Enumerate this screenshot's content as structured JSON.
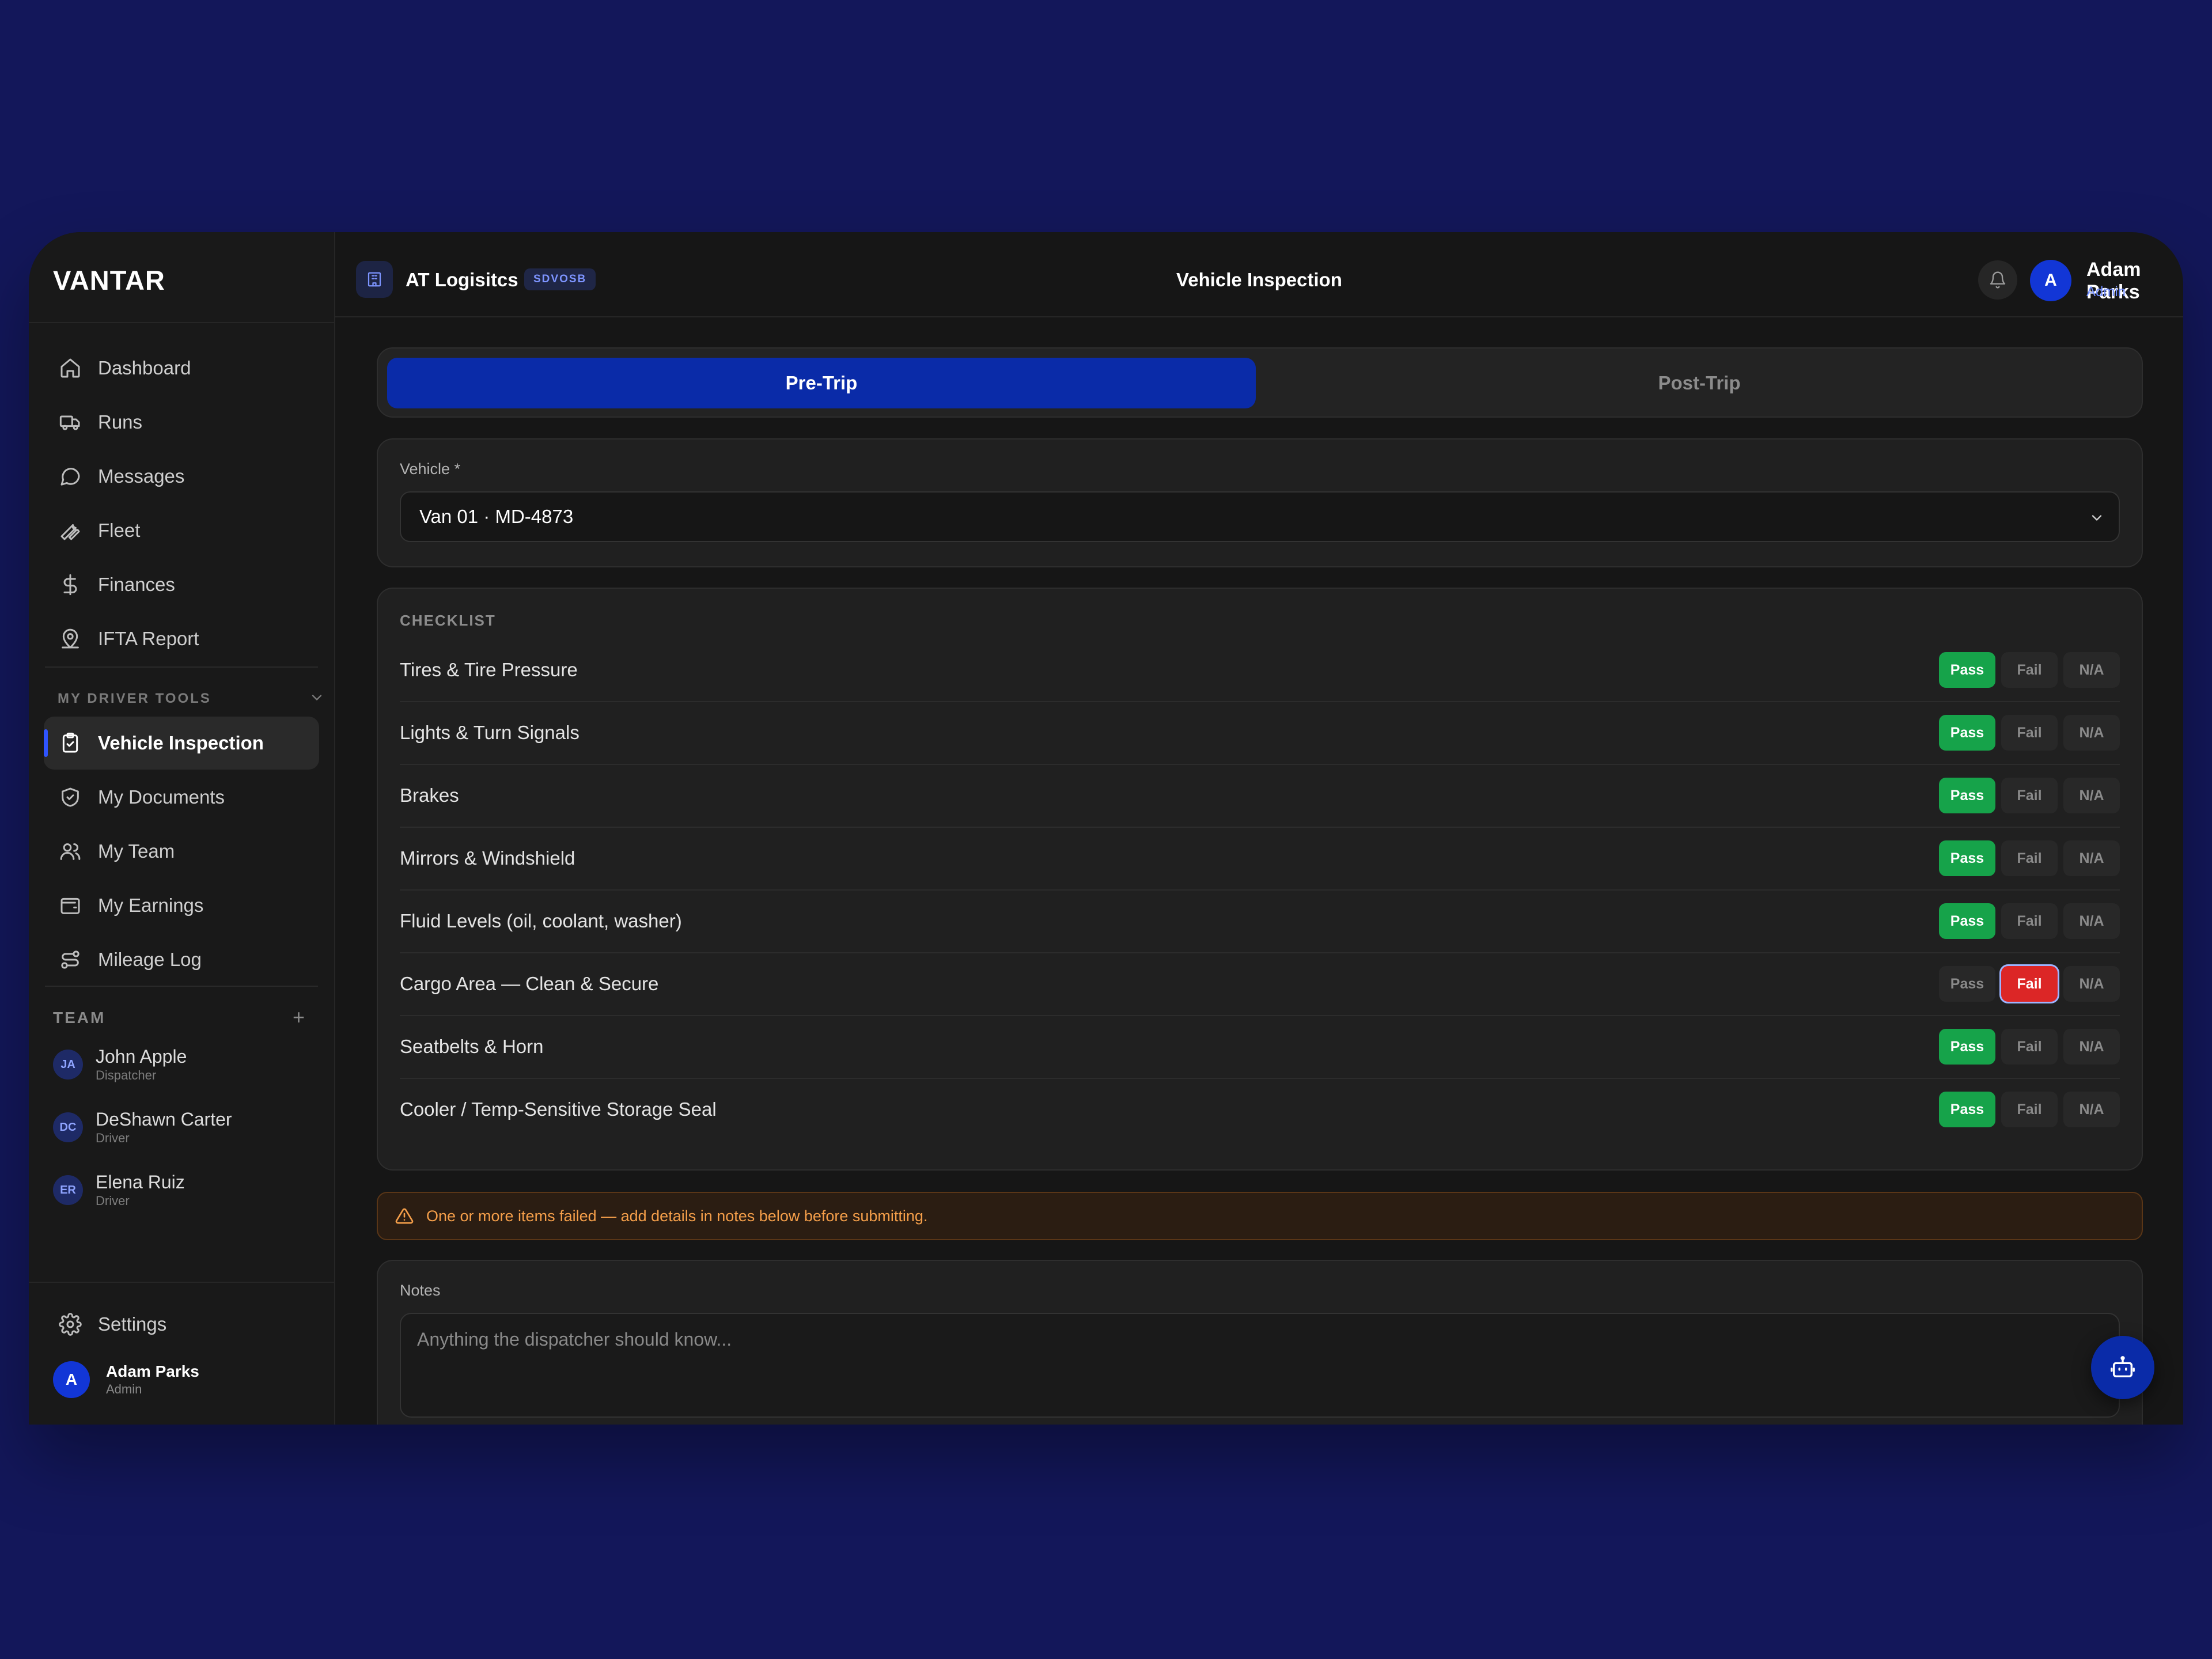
{
  "app": {
    "logo": "VANTAR"
  },
  "sidebar": {
    "nav": [
      {
        "label": "Dashboard",
        "icon": "home-icon"
      },
      {
        "label": "Runs",
        "icon": "truck-icon"
      },
      {
        "label": "Messages",
        "icon": "message-icon"
      },
      {
        "label": "Fleet",
        "icon": "wrench-icon"
      },
      {
        "label": "Finances",
        "icon": "dollar-icon"
      },
      {
        "label": "IFTA Report",
        "icon": "map-pin-icon"
      }
    ],
    "driver_tools_label": "MY DRIVER TOOLS",
    "driver_tools": [
      {
        "label": "Vehicle Inspection",
        "icon": "clipboard-check-icon",
        "active": true
      },
      {
        "label": "My Documents",
        "icon": "shield-check-icon"
      },
      {
        "label": "My Team",
        "icon": "users-icon"
      },
      {
        "label": "My Earnings",
        "icon": "wallet-icon"
      },
      {
        "label": "Mileage Log",
        "icon": "route-icon"
      }
    ],
    "team_label": "TEAM",
    "team": [
      {
        "initials": "JA",
        "name": "John Apple",
        "role": "Dispatcher"
      },
      {
        "initials": "DC",
        "name": "DeShawn Carter",
        "role": "Driver"
      },
      {
        "initials": "ER",
        "name": "Elena Ruiz",
        "role": "Driver"
      }
    ],
    "settings_label": "Settings",
    "user": {
      "initial": "A",
      "name": "Adam Parks",
      "role": "Admin"
    }
  },
  "header": {
    "org_name": "AT Logisitcs",
    "org_badge": "SDVOSB",
    "title": "Vehicle Inspection",
    "user": {
      "initial": "A",
      "name": "Adam Parks",
      "role": "Admin"
    }
  },
  "tabs": [
    {
      "label": "Pre-Trip",
      "active": true
    },
    {
      "label": "Post-Trip",
      "active": false
    }
  ],
  "vehicle": {
    "label": "Vehicle *",
    "value": "Van 01 · MD-4873"
  },
  "checklist": {
    "title": "CHECKLIST",
    "options": [
      "Pass",
      "Fail",
      "N/A"
    ],
    "items": [
      {
        "name": "Tires & Tire Pressure",
        "status": "Pass"
      },
      {
        "name": "Lights & Turn Signals",
        "status": "Pass"
      },
      {
        "name": "Brakes",
        "status": "Pass"
      },
      {
        "name": "Mirrors & Windshield",
        "status": "Pass"
      },
      {
        "name": "Fluid Levels (oil, coolant, washer)",
        "status": "Pass"
      },
      {
        "name": "Cargo Area — Clean & Secure",
        "status": "Fail"
      },
      {
        "name": "Seatbelts & Horn",
        "status": "Pass"
      },
      {
        "name": "Cooler / Temp-Sensitive Storage Seal",
        "status": "Pass"
      }
    ]
  },
  "warning": "One or more items failed — add details in notes below before submitting.",
  "notes": {
    "label": "Notes",
    "placeholder": "Anything the dispatcher should know..."
  },
  "colors": {
    "accent": "#0a2ba8",
    "pass": "#16a34a",
    "fail": "#dc2626",
    "warning": "#f59f4a"
  }
}
